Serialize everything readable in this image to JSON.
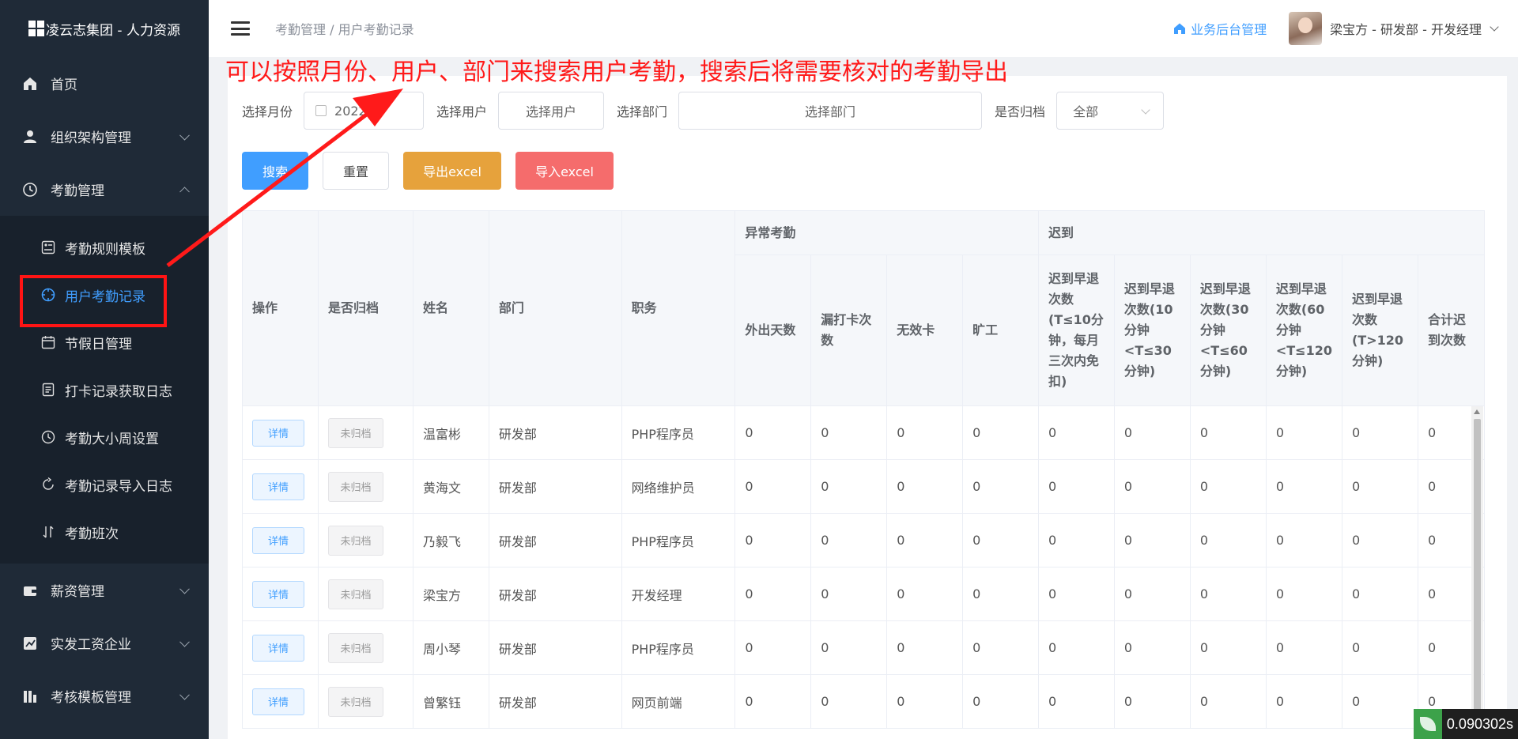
{
  "sidebar": {
    "brand": "凌云志集团 - 人力资源",
    "items": [
      {
        "label": "首页",
        "icon": "home-icon"
      },
      {
        "label": "组织架构管理",
        "icon": "user-icon"
      },
      {
        "label": "考勤管理",
        "icon": "clock-icon"
      }
    ],
    "sub_items": [
      {
        "label": "考勤规则模板",
        "icon": "rules-icon"
      },
      {
        "label": "用户考勤记录",
        "icon": "compass-icon"
      },
      {
        "label": "节假日管理",
        "icon": "calendar-icon"
      },
      {
        "label": "打卡记录获取日志",
        "icon": "document-icon"
      },
      {
        "label": "考勤大小周设置",
        "icon": "clock-icon"
      },
      {
        "label": "考勤记录导入日志",
        "icon": "refresh-icon"
      },
      {
        "label": "考勤班次",
        "icon": "sort-icon"
      }
    ],
    "bottom_items": [
      {
        "label": "薪资管理",
        "icon": "wallet-icon"
      },
      {
        "label": "实发工资企业",
        "icon": "trend-icon"
      },
      {
        "label": "考核模板管理",
        "icon": "bar-icon"
      }
    ]
  },
  "header": {
    "breadcrumb": "考勤管理 / 用户考勤记录",
    "biz_link": "业务后台管理",
    "user": "梁宝方 - 研发部 - 开发经理"
  },
  "annotation": "可以按照月份、用户、部门来搜索用户考勤，搜索后将需要核对的考勤导出",
  "filters": {
    "month_label": "选择月份",
    "month_value": "2022",
    "user_label": "选择用户",
    "user_placeholder": "选择用户",
    "dept_label": "选择部门",
    "dept_placeholder": "选择部门",
    "archive_label": "是否归档",
    "archive_value": "全部"
  },
  "buttons": {
    "search": "搜索",
    "reset": "重置",
    "export": "导出excel",
    "import": "导入excel"
  },
  "table": {
    "headers": {
      "op": "操作",
      "archived": "是否归档",
      "name": "姓名",
      "dept": "部门",
      "position": "职务",
      "abnormal_group": "异常考勤",
      "late_group": "迟到",
      "out_days": "外出天数",
      "missed_punch": "漏打卡次数",
      "invalid_card": "无效卡",
      "absent": "旷工",
      "late_10": "迟到早退次数(T≤10分钟，每月三次内免扣)",
      "late_30": "迟到早退次数(10分钟<T≤30分钟)",
      "late_60": "迟到早退次数(30分钟<T≤60分钟)",
      "late_120": "迟到早退次数(60分钟<T≤120分钟)",
      "late_over": "迟到早退次数(T>120分钟)",
      "late_total": "合计迟到次数"
    },
    "detail_label": "详情",
    "rows": [
      {
        "archived": "未归档",
        "name": "温富彬",
        "dept": "研发部",
        "position": "PHP程序员",
        "vals": [
          "0",
          "0",
          "0",
          "0",
          "0",
          "0",
          "0",
          "0",
          "0",
          "0"
        ]
      },
      {
        "archived": "未归档",
        "name": "黄海文",
        "dept": "研发部",
        "position": "网络维护员",
        "vals": [
          "0",
          "0",
          "0",
          "0",
          "0",
          "0",
          "0",
          "0",
          "0",
          "0"
        ]
      },
      {
        "archived": "未归档",
        "name": "乃毅飞",
        "dept": "研发部",
        "position": "PHP程序员",
        "vals": [
          "0",
          "0",
          "0",
          "0",
          "0",
          "0",
          "0",
          "0",
          "0",
          "0"
        ]
      },
      {
        "archived": "未归档",
        "name": "梁宝方",
        "dept": "研发部",
        "position": "开发经理",
        "vals": [
          "0",
          "0",
          "0",
          "0",
          "0",
          "0",
          "0",
          "0",
          "0",
          "0"
        ]
      },
      {
        "archived": "未归档",
        "name": "周小琴",
        "dept": "研发部",
        "position": "PHP程序员",
        "vals": [
          "0",
          "0",
          "0",
          "0",
          "0",
          "0",
          "0",
          "0",
          "0",
          "0"
        ]
      },
      {
        "archived": "未归档",
        "name": "曾繁钰",
        "dept": "研发部",
        "position": "网页前端",
        "vals": [
          "0",
          "0",
          "0",
          "0",
          "0",
          "0",
          "0",
          "0",
          "0",
          "0"
        ]
      }
    ]
  },
  "timer": "0.090302s",
  "colors": {
    "primary": "#409eff",
    "warning": "#e6a23c",
    "danger": "#f56c6c",
    "annotation": "#ff1a1a",
    "sidebar": "#1f2a37"
  }
}
